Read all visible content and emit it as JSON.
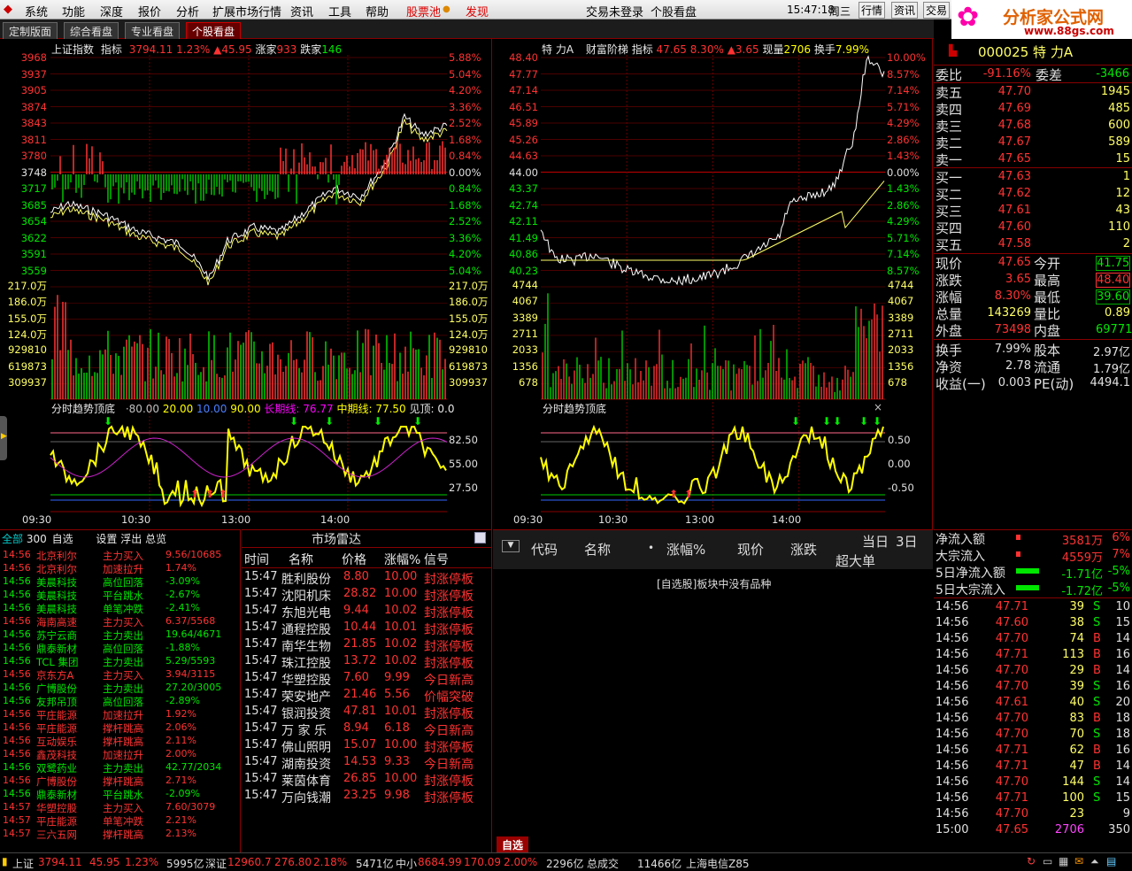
{
  "menu": {
    "items": [
      "系统",
      "功能",
      "深度",
      "报价",
      "分析",
      "扩展市场行情",
      "资讯",
      "工具",
      "帮助"
    ],
    "special1": "股票池",
    "special2": "发现",
    "login": "交易未登录",
    "view": "个股看盘",
    "time": "15:47:18",
    "weekday": "周三",
    "btn1": "行情",
    "btn2": "资讯",
    "btn3": "交易",
    "logo_text": "分析家公式网",
    "logo_url": "www.88gs.com"
  },
  "tabs": [
    "定制版面",
    "综合看盘",
    "专业看盘",
    "个股看盘"
  ],
  "index_chart": {
    "name": "上证指数",
    "ind_label": "指标",
    "price": "3794.11",
    "pct": "1.23%",
    "chg": "▲45.95",
    "up_label": "涨家",
    "up": "933",
    "down_label": "跌家",
    "down": "146",
    "left_axis": [
      "3968",
      "3937",
      "3905",
      "3874",
      "3843",
      "3811",
      "3780",
      "3748",
      "3717",
      "3685",
      "3654",
      "3622",
      "3591",
      "3559"
    ],
    "right_axis": [
      "5.88%",
      "5.04%",
      "4.20%",
      "3.36%",
      "2.52%",
      "1.68%",
      "0.84%",
      "0.00%",
      "0.84%",
      "1.68%",
      "2.52%",
      "3.36%",
      "4.20%",
      "5.04%"
    ],
    "vol_axis": [
      "217.0万",
      "186.0万",
      "155.0万",
      "124.0万",
      "929810",
      "619873",
      "309937"
    ],
    "osc_title": "分时趋势顶底",
    "osc_vals": [
      "80.00",
      "20.00",
      "10.00",
      "90.00"
    ],
    "long_lbl": "长期线: 76.77",
    "mid_lbl": "中期线: 77.50",
    "top_lbl": "见顶: 0.0",
    "osc_axis": [
      "82.50",
      "55.00",
      "27.50"
    ],
    "time_axis": [
      "09:30",
      "10:30",
      "13:00",
      "14:00"
    ]
  },
  "stock_chart": {
    "name": "特 力A",
    "ind_label": "财富阶梯",
    "ind2": "指标",
    "price": "47.65",
    "pct": "8.30%",
    "chg": "▲3.65",
    "vol_lbl": "现量",
    "vol": "2706",
    "turn_lbl": "换手",
    "turn": "7.99%",
    "left_axis": [
      "48.40",
      "47.77",
      "47.14",
      "46.51",
      "45.89",
      "45.26",
      "44.63",
      "44.00",
      "43.37",
      "42.74",
      "42.11",
      "41.49",
      "40.86",
      "40.23"
    ],
    "right_axis": [
      "10.00%",
      "8.57%",
      "7.14%",
      "5.71%",
      "4.29%",
      "2.86%",
      "1.43%",
      "0.00%",
      "1.43%",
      "2.86%",
      "4.29%",
      "5.71%",
      "7.14%",
      "8.57%"
    ],
    "vol_axis": [
      "4744",
      "4067",
      "3389",
      "2711",
      "2033",
      "1356",
      "678"
    ],
    "osc_title": "分时趋势顶底",
    "osc_axis": [
      "0.50",
      "0.00",
      "-0.50"
    ],
    "time_axis": [
      "09:30",
      "10:30",
      "13:00",
      "14:00"
    ]
  },
  "quote": {
    "code": "000025",
    "name": "特 力A",
    "wb_lbl": "委比",
    "wb": "-91.16%",
    "wc_lbl": "委差",
    "wc": "-3466",
    "asks": [
      {
        "l": "卖五",
        "p": "47.70",
        "v": "1945"
      },
      {
        "l": "卖四",
        "p": "47.69",
        "v": "485"
      },
      {
        "l": "卖三",
        "p": "47.68",
        "v": "600"
      },
      {
        "l": "卖二",
        "p": "47.67",
        "v": "589"
      },
      {
        "l": "卖一",
        "p": "47.65",
        "v": "15"
      }
    ],
    "bids": [
      {
        "l": "买一",
        "p": "47.63",
        "v": "1"
      },
      {
        "l": "买二",
        "p": "47.62",
        "v": "12"
      },
      {
        "l": "买三",
        "p": "47.61",
        "v": "43"
      },
      {
        "l": "买四",
        "p": "47.60",
        "v": "110"
      },
      {
        "l": "买五",
        "p": "47.58",
        "v": "2"
      }
    ],
    "stats": [
      {
        "l1": "现价",
        "v1": "47.65",
        "c1": "red",
        "l2": "今开",
        "v2": "41.75",
        "c2": "grn"
      },
      {
        "l1": "涨跌",
        "v1": "3.65",
        "c1": "red",
        "l2": "最高",
        "v2": "48.40",
        "c2": "red"
      },
      {
        "l1": "涨幅",
        "v1": "8.30%",
        "c1": "red",
        "l2": "最低",
        "v2": "39.60",
        "c2": "grn"
      },
      {
        "l1": "总量",
        "v1": "143269",
        "c1": "yel",
        "l2": "量比",
        "v2": "0.89",
        "c2": "yel"
      },
      {
        "l1": "外盘",
        "v1": "73498",
        "c1": "red",
        "l2": "内盘",
        "v2": "69771",
        "c2": "grn"
      }
    ],
    "stats2": [
      {
        "l1": "换手",
        "v1": "7.99%",
        "l2": "股本",
        "v2": "2.97亿"
      },
      {
        "l1": "净资",
        "v1": "2.78",
        "l2": "流通",
        "v2": "1.79亿"
      },
      {
        "l1": "收益(一)",
        "v1": "0.003",
        "l2": "PE(动)",
        "v2": "4494.1"
      }
    ]
  },
  "flow": [
    {
      "l": "净流入额",
      "v": "3581万",
      "p": "6%",
      "c": "red"
    },
    {
      "l": "大宗流入",
      "v": "4559万",
      "p": "7%",
      "c": "red"
    },
    {
      "l": "5日净流入额",
      "v": "-1.71亿",
      "p": "-5%",
      "c": "grn"
    },
    {
      "l": "5日大宗流入",
      "v": "-1.72亿",
      "p": "-5%",
      "c": "grn"
    }
  ],
  "ticks": [
    {
      "t": "14:56",
      "p": "47.71",
      "v": "39",
      "s": "S",
      "n": "10"
    },
    {
      "t": "14:56",
      "p": "47.60",
      "v": "38",
      "s": "S",
      "n": "15"
    },
    {
      "t": "14:56",
      "p": "47.70",
      "v": "74",
      "s": "B",
      "n": "14"
    },
    {
      "t": "14:56",
      "p": "47.71",
      "v": "113",
      "s": "B",
      "n": "16"
    },
    {
      "t": "14:56",
      "p": "47.70",
      "v": "29",
      "s": "B",
      "n": "14"
    },
    {
      "t": "14:56",
      "p": "47.70",
      "v": "39",
      "s": "S",
      "n": "16"
    },
    {
      "t": "14:56",
      "p": "47.61",
      "v": "40",
      "s": "S",
      "n": "20"
    },
    {
      "t": "14:56",
      "p": "47.70",
      "v": "83",
      "s": "B",
      "n": "18"
    },
    {
      "t": "14:56",
      "p": "47.70",
      "v": "70",
      "s": "S",
      "n": "18"
    },
    {
      "t": "14:56",
      "p": "47.71",
      "v": "62",
      "s": "B",
      "n": "16"
    },
    {
      "t": "14:56",
      "p": "47.71",
      "v": "47",
      "s": "B",
      "n": "14"
    },
    {
      "t": "14:56",
      "p": "47.70",
      "v": "144",
      "s": "S",
      "n": "14"
    },
    {
      "t": "14:56",
      "p": "47.71",
      "v": "100",
      "s": "S",
      "n": "15"
    },
    {
      "t": "14:56",
      "p": "47.70",
      "v": "23",
      "s": "",
      "n": "9"
    },
    {
      "t": "15:00",
      "p": "47.65",
      "v": "2706",
      "s": "",
      "n": "350"
    }
  ],
  "watch": {
    "tabs": [
      "全部",
      "300",
      "自选",
      "设置",
      "浮出",
      "总览"
    ],
    "rows": [
      {
        "t": "14:56",
        "n": "北京利尔",
        "a": "主力买入",
        "v": "9.56/10685",
        "c": "red"
      },
      {
        "t": "14:56",
        "n": "北京利尔",
        "a": "加速拉升",
        "v": "1.74%",
        "c": "red"
      },
      {
        "t": "14:56",
        "n": "美晨科技",
        "a": "高位回落",
        "v": "-3.09%",
        "c": "grn"
      },
      {
        "t": "14:56",
        "n": "美晨科技",
        "a": "平台跳水",
        "v": "-2.67%",
        "c": "grn"
      },
      {
        "t": "14:56",
        "n": "美晨科技",
        "a": "单笔冲跌",
        "v": "-2.41%",
        "c": "grn"
      },
      {
        "t": "14:56",
        "n": "海南高速",
        "a": "主力买入",
        "v": "6.37/5568",
        "c": "red"
      },
      {
        "t": "14:56",
        "n": "苏宁云商",
        "a": "主力卖出",
        "v": "19.64/4671",
        "c": "grn"
      },
      {
        "t": "14:56",
        "n": "鼎泰新材",
        "a": "高位回落",
        "v": "-1.88%",
        "c": "grn"
      },
      {
        "t": "14:56",
        "n": "TCL 集团",
        "a": "主力卖出",
        "v": "5.29/5593",
        "c": "grn"
      },
      {
        "t": "14:56",
        "n": "京东方A",
        "a": "主力买入",
        "v": "3.94/3115",
        "c": "red"
      },
      {
        "t": "14:56",
        "n": "广博股份",
        "a": "主力卖出",
        "v": "27.20/3005",
        "c": "grn"
      },
      {
        "t": "14:56",
        "n": "友邦吊顶",
        "a": "高位回落",
        "v": "-2.89%",
        "c": "grn"
      },
      {
        "t": "14:56",
        "n": "平庄能源",
        "a": "加速拉升",
        "v": "1.92%",
        "c": "red"
      },
      {
        "t": "14:56",
        "n": "平庄能源",
        "a": "撑杆跳高",
        "v": "2.06%",
        "c": "red"
      },
      {
        "t": "14:56",
        "n": "互动娱乐",
        "a": "撑杆跳高",
        "v": "2.11%",
        "c": "red"
      },
      {
        "t": "14:56",
        "n": "鑫茂科技",
        "a": "加速拉升",
        "v": "2.00%",
        "c": "red"
      },
      {
        "t": "14:56",
        "n": "双鹭药业",
        "a": "主力卖出",
        "v": "42.77/2034",
        "c": "grn"
      },
      {
        "t": "14:56",
        "n": "广博股份",
        "a": "撑杆跳高",
        "v": "2.71%",
        "c": "red"
      },
      {
        "t": "14:56",
        "n": "鼎泰新材",
        "a": "平台跳水",
        "v": "-2.09%",
        "c": "grn"
      },
      {
        "t": "14:57",
        "n": "华塑控股",
        "a": "主力买入",
        "v": "7.60/3079",
        "c": "red"
      },
      {
        "t": "14:57",
        "n": "平庄能源",
        "a": "单笔冲跌",
        "v": "2.21%",
        "c": "red"
      },
      {
        "t": "14:57",
        "n": "三六五网",
        "a": "撑杆跳高",
        "v": "2.13%",
        "c": "red"
      }
    ]
  },
  "radar": {
    "title": "市场雷达",
    "cols": [
      "时间",
      "名称",
      "价格",
      "涨幅%",
      "信号"
    ],
    "rows": [
      {
        "t": "15:47",
        "n": "胜利股份",
        "p": "8.80",
        "z": "10.00",
        "s": "封涨停板"
      },
      {
        "t": "15:47",
        "n": "沈阳机床",
        "p": "28.82",
        "z": "10.00",
        "s": "封涨停板"
      },
      {
        "t": "15:47",
        "n": "东旭光电",
        "p": "9.44",
        "z": "10.02",
        "s": "封涨停板"
      },
      {
        "t": "15:47",
        "n": "通程控股",
        "p": "10.44",
        "z": "10.01",
        "s": "封涨停板"
      },
      {
        "t": "15:47",
        "n": "南华生物",
        "p": "21.85",
        "z": "10.02",
        "s": "封涨停板"
      },
      {
        "t": "15:47",
        "n": "珠江控股",
        "p": "13.72",
        "z": "10.02",
        "s": "封涨停板"
      },
      {
        "t": "15:47",
        "n": "华塑控股",
        "p": "7.60",
        "z": "9.99",
        "s": "今日新高"
      },
      {
        "t": "15:47",
        "n": "荣安地产",
        "p": "21.46",
        "z": "5.56",
        "s": "价幅突破"
      },
      {
        "t": "15:47",
        "n": "银润投资",
        "p": "47.81",
        "z": "10.01",
        "s": "封涨停板"
      },
      {
        "t": "15:47",
        "n": "万 家 乐",
        "p": "8.94",
        "z": "6.18",
        "s": "今日新高"
      },
      {
        "t": "15:47",
        "n": "佛山照明",
        "p": "15.07",
        "z": "10.00",
        "s": "封涨停板"
      },
      {
        "t": "15:47",
        "n": "湖南投资",
        "p": "14.53",
        "z": "9.33",
        "s": "今日新高"
      },
      {
        "t": "15:47",
        "n": "莱茵体育",
        "p": "26.85",
        "z": "10.00",
        "s": "封涨停板"
      },
      {
        "t": "15:47",
        "n": "万向钱潮",
        "p": "23.25",
        "z": "9.98",
        "s": "封涨停板"
      }
    ]
  },
  "list": {
    "cols": [
      "代码",
      "名称",
      "涨幅%",
      "现价",
      "涨跌"
    ],
    "today": "当日",
    "three": "3日",
    "big": "超大单",
    "empty": "[自选股]板块中没有品种",
    "tab": "自选"
  },
  "status": {
    "sh_lbl": "上证",
    "sh": "3794.11",
    "sh_chg": "45.95",
    "sh_pct": "1.23%",
    "sh_amt": "5995亿",
    "sz_lbl": "深证",
    "sz": "12960.7",
    "sz_chg": "276.80",
    "sz_pct": "2.18%",
    "sz_amt": "5471亿",
    "zx_lbl": "中小",
    "zx": "8684.99",
    "zx_chg": "170.09",
    "zx_pct": "2.00%",
    "zx_amt": "2296亿",
    "total_lbl": "总成交",
    "total": "11466亿",
    "isp": "上海电信Z85"
  }
}
